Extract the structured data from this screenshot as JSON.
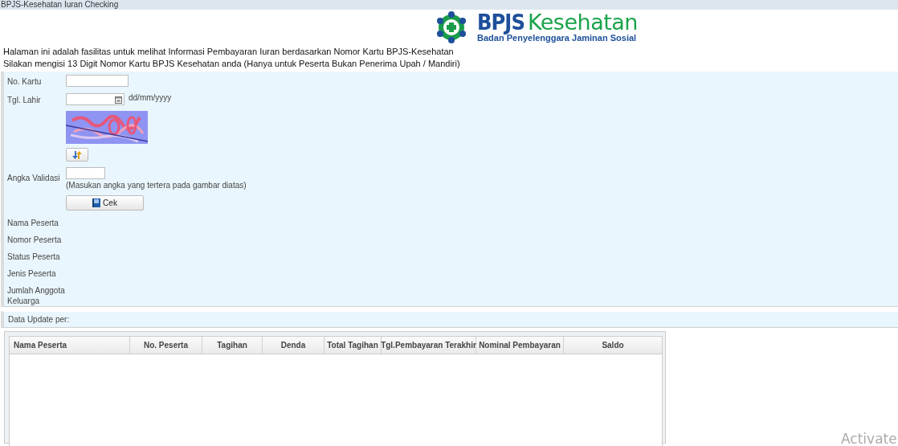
{
  "window": {
    "title": "BPJS-Kesehatan Iuran Checking"
  },
  "header": {
    "brand": "BPJS",
    "brand_accent": "Kesehatan",
    "tagline": "Badan Penyelenggara Jaminan Sosial"
  },
  "intro": [
    "Halaman ini adalah fasilitas untuk melihat Informasi Pembayaran Iuran berdasarkan Nomor Kartu BPJS-Kesehatan",
    "Silakan mengisi 13 Digit Nomor Kartu BPJS Kesehatan anda (Hanya untuk Peserta Bukan Penerima Upah / Mandiri)"
  ],
  "form": {
    "fields": [
      {
        "label": "No. Kartu",
        "kind": "text"
      },
      {
        "label": "Tgl. Lahir",
        "kind": "date",
        "hint": "dd/mm/yyyy"
      }
    ],
    "validation": {
      "label": "Angka Validasi",
      "hint": "(Masukan angka yang tertera pada gambar diatas)"
    },
    "submit": "Cek",
    "results": [
      "Nama Peserta",
      "Nomor Peserta",
      "Status Peserta",
      "Jenis Peserta",
      "Jumlah Anggota Keluarga"
    ]
  },
  "update": {
    "label": "Data Update per:"
  },
  "table": {
    "columns": [
      "Nama Peserta",
      "No. Peserta",
      "Tagihan",
      "Denda",
      "Total Tagihan",
      "Tgl.Pembayaran Terakhir",
      "Nominal Pembayaran",
      "Saldo"
    ]
  },
  "overlay": {
    "text": "Activate"
  }
}
